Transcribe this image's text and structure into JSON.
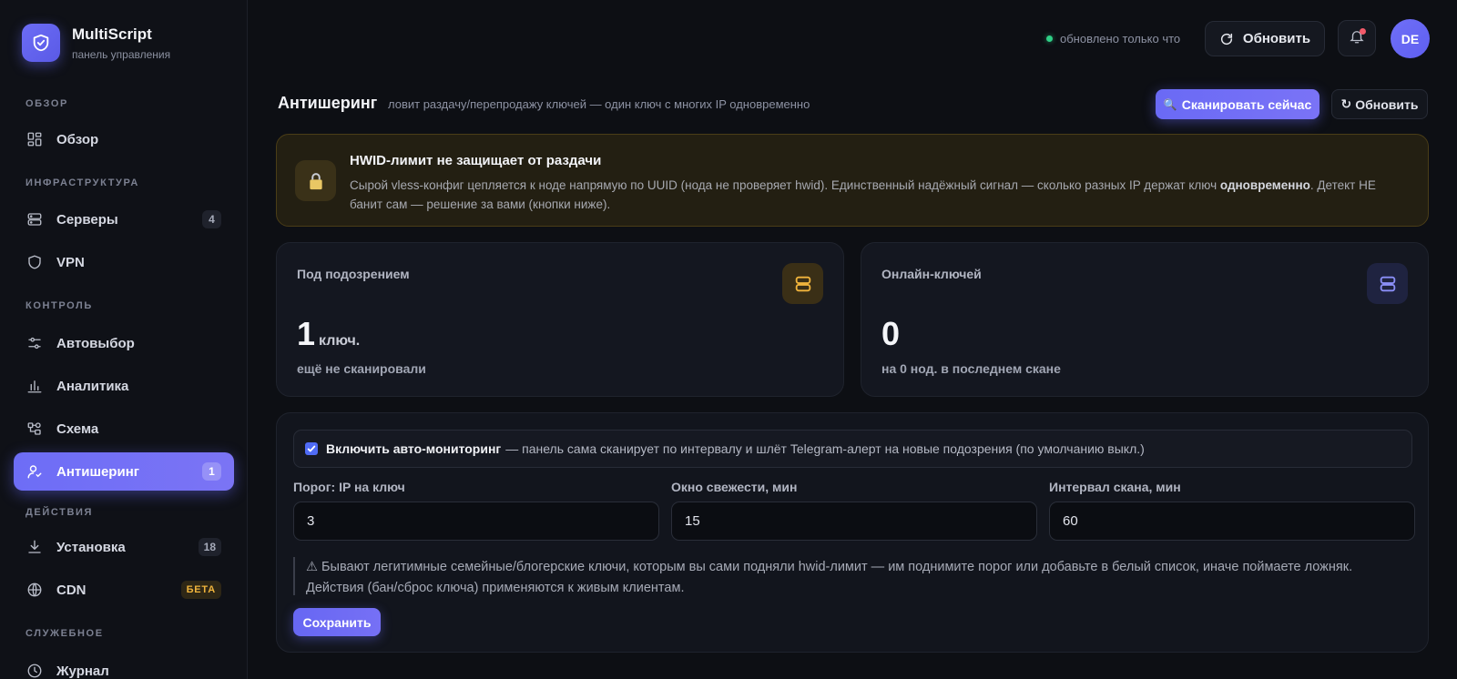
{
  "brand": {
    "name": "MultiScript",
    "subtitle": "панель управления"
  },
  "sidebar": {
    "sections": [
      {
        "label": "ОБЗОР"
      },
      {
        "label": "ИНФРАСТРУКТУРА"
      },
      {
        "label": "КОНТРОЛЬ"
      },
      {
        "label": "ДЕЙСТВИЯ"
      },
      {
        "label": "СЛУЖЕБНОЕ"
      }
    ],
    "items": [
      {
        "label": "Обзор",
        "icon": "grid-icon"
      },
      {
        "label": "Серверы",
        "icon": "server-icon",
        "badge": "4"
      },
      {
        "label": "VPN",
        "icon": "shield-icon"
      },
      {
        "label": "Автовыбор",
        "icon": "sliders-icon"
      },
      {
        "label": "Аналитика",
        "icon": "bar-chart-icon"
      },
      {
        "label": "Схема",
        "icon": "diagram-icon"
      },
      {
        "label": "Антишеринг",
        "icon": "user-icon",
        "badge": "1",
        "active": true
      },
      {
        "label": "Установка",
        "icon": "download-icon",
        "badge": "18"
      },
      {
        "label": "CDN",
        "icon": "globe-icon",
        "badge": "БЕТА"
      },
      {
        "label": "Журнал",
        "icon": "clock-icon"
      }
    ]
  },
  "topbar": {
    "status": "обновлено только что",
    "refresh_label": "Обновить",
    "avatar_initials": "DE"
  },
  "page": {
    "title": "Антишеринг",
    "description": "ловит раздачу/перепродажу ключей — один ключ с многих IP одновременно",
    "scan_label": "Сканировать сейчас",
    "refresh_label": "Обновить"
  },
  "warning": {
    "title": "HWID-лимит не защищает от раздачи",
    "text_before": "Сырой vless-конфиг цепляется к ноде напрямую по UUID (нода не проверяет hwid). Единственный надёжный сигнал — сколько разных IP держат ключ ",
    "text_bold": "одновременно",
    "text_after": ". Детект НЕ банит сам — решение за вами (кнопки ниже)."
  },
  "cards": [
    {
      "label": "Под подозрением",
      "value": "1",
      "unit": "ключ.",
      "sub": "ещё не сканировали",
      "icon": "stack-icon",
      "accent": "#f0b43c"
    },
    {
      "label": "Онлайн-ключей",
      "value": "0",
      "unit": "",
      "sub": "на 0 нод. в последнем скане",
      "icon": "stack-icon",
      "accent": "#8b8ff7"
    }
  ],
  "settings": {
    "auto_monitor_checked": true,
    "auto_monitor_title": "Включить авто-мониторинг",
    "auto_monitor_desc": "— панель сама сканирует по интервалу и шлёт Telegram-алерт на новые подозрения (по умолчанию выкл.)",
    "fields": [
      {
        "label": "Порог: IP на ключ",
        "value": "3"
      },
      {
        "label": "Окно свежести, мин",
        "value": "15"
      },
      {
        "label": "Интервал скана, мин",
        "value": "60"
      }
    ],
    "note": "⚠ Бывают легитимные семейные/блогерские ключи, которым вы сами подняли hwid-лимит — им поднимите порог или добавьте в белый список, иначе поймаете ложняк. Действия (бан/сброс ключа) применяются к живым клиентам.",
    "save_label": "Сохранить"
  }
}
